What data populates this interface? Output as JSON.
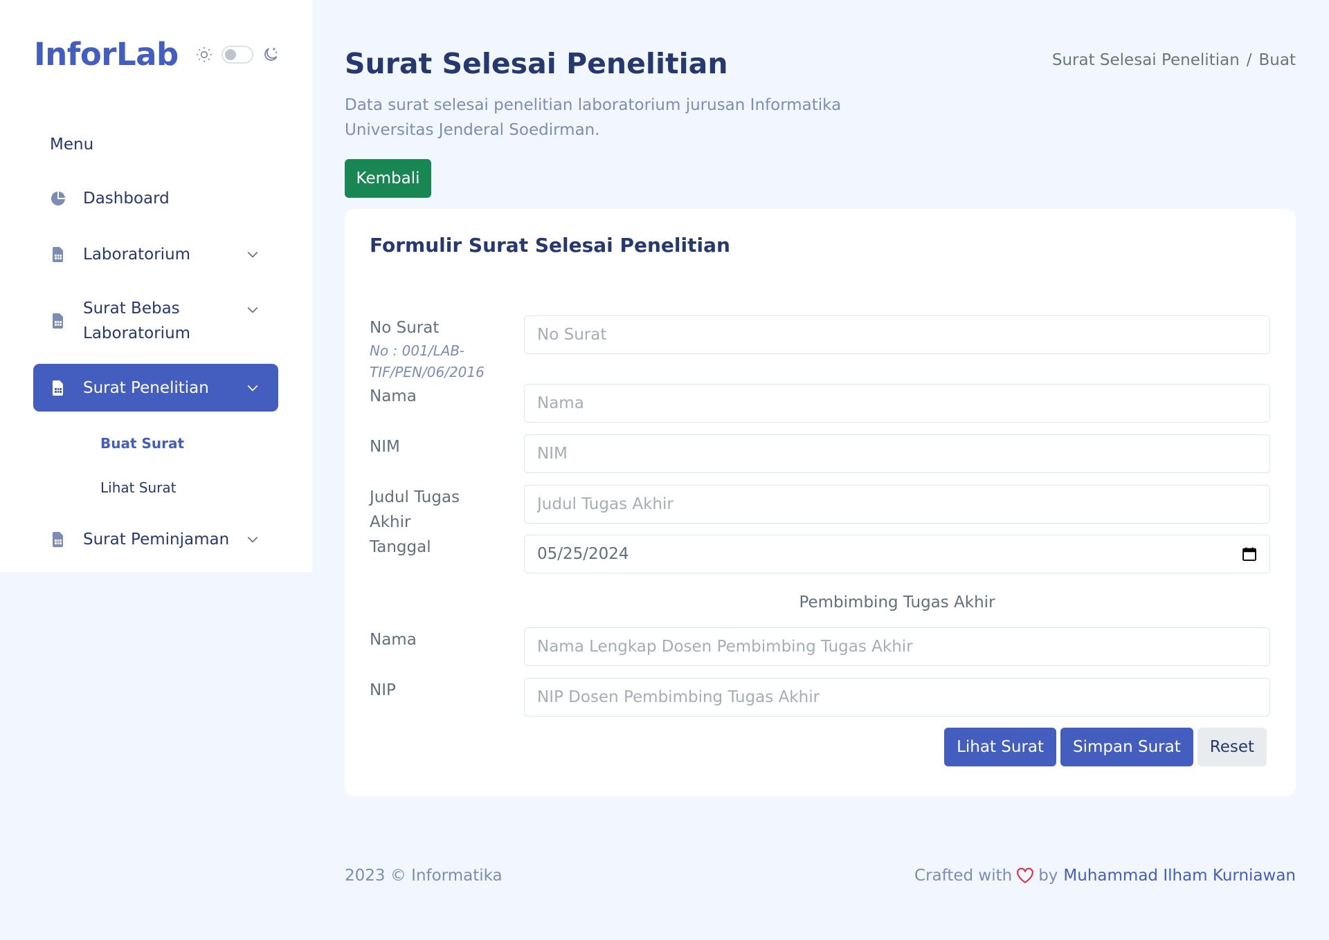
{
  "brand": {
    "name": "InforLab"
  },
  "sidebar": {
    "menu_title": "Menu",
    "items": [
      {
        "label": "Dashboard",
        "icon": "pie-chart-icon",
        "has_submenu": false
      },
      {
        "label": "Laboratorium",
        "icon": "file-spreadsheet-icon",
        "has_submenu": true
      },
      {
        "label": "Surat Bebas Laboratorium",
        "icon": "file-spreadsheet-icon",
        "has_submenu": true
      },
      {
        "label": "Surat Penelitian",
        "icon": "file-spreadsheet-icon",
        "has_submenu": true,
        "active": true,
        "submenu": [
          {
            "label": "Buat Surat",
            "current": true
          },
          {
            "label": "Lihat Surat"
          }
        ]
      },
      {
        "label": "Surat Peminjaman",
        "icon": "file-spreadsheet-icon",
        "has_submenu": true
      }
    ]
  },
  "header": {
    "title": "Surat Selesai Penelitian",
    "subtitle": "Data surat selesai penelitian laboratorium jurusan Informatika Universitas Jenderal Soedirman.",
    "breadcrumb": [
      "Surat Selesai Penelitian",
      "Buat"
    ],
    "back_label": "Kembali"
  },
  "form": {
    "title": "Formulir Surat Selesai Penelitian",
    "no_surat": {
      "label": "No Surat",
      "hint": "No : 001/LAB-TIF/PEN/06/2016",
      "placeholder": "No Surat"
    },
    "nama": {
      "label": "Nama",
      "placeholder": "Nama"
    },
    "nim": {
      "label": "NIM",
      "placeholder": "NIM"
    },
    "judul": {
      "label": "Judul Tugas Akhir",
      "placeholder": "Judul Tugas Akhir"
    },
    "tanggal": {
      "label": "Tanggal",
      "value": "05/25/2024"
    },
    "pembimbing_caption": "Pembimbing Tugas Akhir",
    "pembimbing_nama": {
      "label": "Nama",
      "placeholder": "Nama Lengkap Dosen Pembimbing Tugas Akhir"
    },
    "pembimbing_nip": {
      "label": "NIP",
      "placeholder": "NIP Dosen Pembimbing Tugas Akhir"
    },
    "buttons": {
      "view": "Lihat Surat",
      "save": "Simpan Surat",
      "reset": "Reset"
    }
  },
  "footer": {
    "copyright": "2023 © Informatika",
    "crafted_prefix": "Crafted with",
    "crafted_by": "by",
    "author": "Muhammad Ilham Kurniawan"
  },
  "colors": {
    "primary": "#435ebe",
    "success": "#198754",
    "background": "#f2f7ff",
    "heart": "#dc3545"
  }
}
